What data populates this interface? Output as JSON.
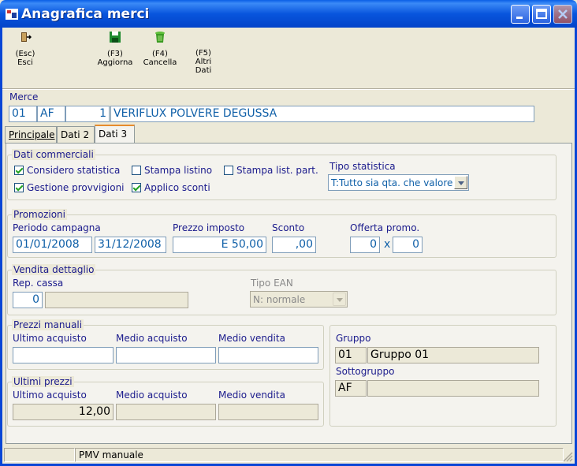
{
  "window": {
    "title": "Anagrafica merci"
  },
  "toolbar": {
    "esc": {
      "key": "(Esc)",
      "label": "Esci"
    },
    "f3": {
      "key": "(F3)",
      "label": "Aggiorna"
    },
    "f4": {
      "key": "(F4)",
      "label": "Cancella"
    },
    "f5": {
      "key": "(F5)",
      "label1": "Altri",
      "label2": "Dati"
    }
  },
  "merce": {
    "label": "Merce",
    "codice1": "01",
    "codice2": "AF",
    "numero": "1",
    "descrizione": "VERIFLUX POLVERE DEGUSSA"
  },
  "tabs": {
    "principale": "Principale",
    "dati2": "Dati 2",
    "dati3": "Dati 3"
  },
  "dati_commerciali": {
    "title": "Dati commerciali",
    "considero_statistica": "Considero statistica",
    "stampa_listino": "Stampa listino",
    "stampa_list_part": "Stampa list. part.",
    "gestione_provvigioni": "Gestione provvigioni",
    "applico_sconti": "Applico sconti",
    "tipo_statistica_label": "Tipo statistica",
    "tipo_statistica_value": "T:Tutto sia qta. che valore"
  },
  "promozioni": {
    "title": "Promozioni",
    "periodo_label": "Periodo campagna",
    "data_inizio": "01/01/2008",
    "data_fine": "31/12/2008",
    "prezzo_label": "Prezzo imposto",
    "prezzo_value": "E 50,00",
    "sconto_label": "Sconto",
    "sconto_value": ",00",
    "offerta_label": "Offerta promo.",
    "offerta_a": "0",
    "offerta_x": "x",
    "offerta_b": "0"
  },
  "vendita_dettaglio": {
    "title": "Vendita dettaglio",
    "rep_cassa_label": "Rep. cassa",
    "rep_cassa_value": "0",
    "tipo_ean_label": "Tipo EAN",
    "tipo_ean_value": "N: normale"
  },
  "prezzi_manuali": {
    "title": "Prezzi manuali",
    "ultimo_label": "Ultimo acquisto",
    "medio_acq_label": "Medio acquisto",
    "medio_vend_label": "Medio vendita"
  },
  "ultimi_prezzi": {
    "title": "Ultimi prezzi",
    "ultimo_label": "Ultimo acquisto",
    "ultimo_value": "12,00",
    "medio_acq_label": "Medio acquisto",
    "medio_vend_label": "Medio vendita"
  },
  "gruppo": {
    "gruppo_label": "Gruppo",
    "gruppo_code": "01",
    "gruppo_desc": "Gruppo 01",
    "sottogruppo_label": "Sottogruppo",
    "sottogruppo_code": "AF",
    "sottogruppo_desc": ""
  },
  "status": {
    "text": "PMV manuale"
  }
}
